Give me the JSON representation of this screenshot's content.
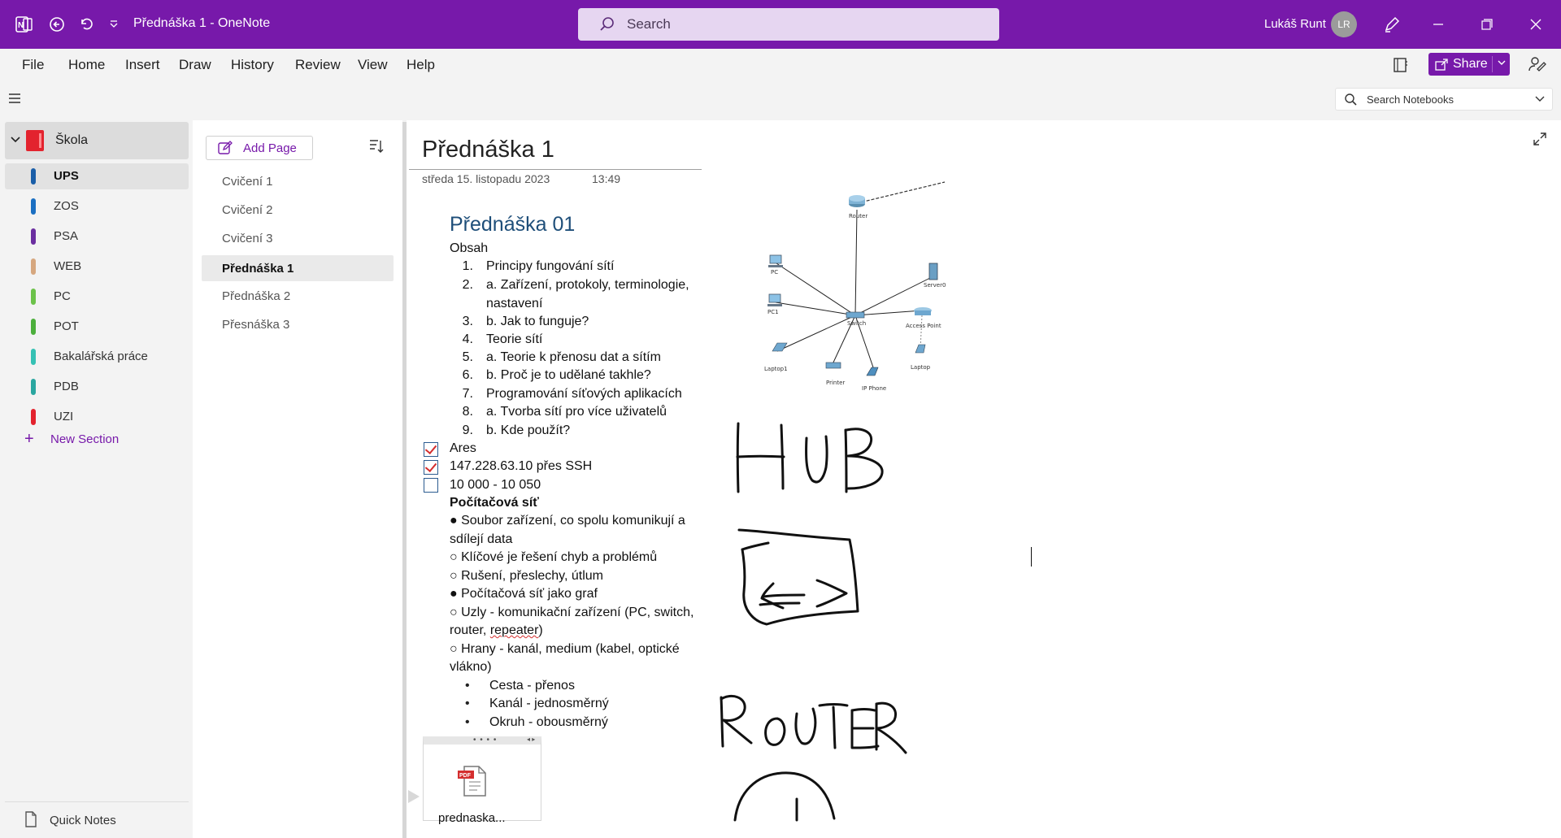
{
  "window": {
    "title": "Přednáška 1  -  OneNote",
    "search_placeholder": "Search",
    "user_name": "Lukáš Runt",
    "user_initials": "LR"
  },
  "menu": [
    "File",
    "Home",
    "Insert",
    "Draw",
    "History",
    "Review",
    "View",
    "Help"
  ],
  "share_label": "Share",
  "notebook_search_placeholder": "Search Notebooks",
  "notebook": {
    "name": "Škola",
    "color": "#e3232e",
    "sections": [
      {
        "label": "UPS",
        "color": "#1a5ea8",
        "active": true
      },
      {
        "label": "ZOS",
        "color": "#1b6fc2",
        "active": false
      },
      {
        "label": "PSA",
        "color": "#6b2fa0",
        "active": false
      },
      {
        "label": "WEB",
        "color": "#d6a77f",
        "active": false
      },
      {
        "label": "PC",
        "color": "#6cc24a",
        "active": false
      },
      {
        "label": "POT",
        "color": "#4caf3c",
        "active": false
      },
      {
        "label": "Bakalářská práce",
        "color": "#35c1b4",
        "active": false
      },
      {
        "label": "PDB",
        "color": "#2aa6a0",
        "active": false
      },
      {
        "label": "UZI",
        "color": "#e3232e",
        "active": false
      }
    ],
    "new_section_label": "New Section",
    "quick_notes_label": "Quick Notes"
  },
  "pages_panel": {
    "add_page_label": "Add Page",
    "pages": [
      {
        "label": "Cvičení 1",
        "active": false
      },
      {
        "label": "Cvičení 2",
        "active": false
      },
      {
        "label": "Cvičení 3",
        "active": false
      },
      {
        "label": "Přednáška 1",
        "active": true
      },
      {
        "label": "Přednáška 2",
        "active": false
      },
      {
        "label": "Přesnáška 3",
        "active": false
      }
    ]
  },
  "page": {
    "title": "Přednáška 1",
    "date": "středa 15. listopadu 2023",
    "time": "13:49",
    "heading": "Přednáška 01",
    "obsah_label": "Obsah",
    "toc": [
      {
        "num": "1.",
        "text": "Principy fungování sítí"
      },
      {
        "num": "2.",
        "text": "a. Zařízení, protokoly, terminologie,"
      },
      {
        "num": "",
        "text": "nastavení"
      },
      {
        "num": "3.",
        "text": "b. Jak to funguje?"
      },
      {
        "num": "4.",
        "text": "Teorie sítí"
      },
      {
        "num": "5.",
        "text": "a. Teorie k přenosu dat a sítím"
      },
      {
        "num": "6.",
        "text": "b. Proč je to udělané takhle?"
      },
      {
        "num": "7.",
        "text": "Programování síťových aplikacích"
      },
      {
        "num": "8.",
        "text": "a. Tvorba sítí pro více uživatelů"
      },
      {
        "num": "9.",
        "text": "b. Kde použít?"
      }
    ],
    "todos": [
      {
        "text": "Ares",
        "checked": true
      },
      {
        "text": "147.228.63.10 přes SSH",
        "checked": true
      },
      {
        "text": "10 000 - 10 050",
        "checked": false
      }
    ],
    "section_title": "Počítačová síť",
    "body_lines": [
      "● Soubor zařízení, co spolu komunikují a",
      "sdílejí data",
      "○ Klíčové je řešení chyb a problémů",
      "○ Rušení, přeslechy, útlum",
      "● Počítačová síť jako graf",
      "○ Uzly - komunikační zařízení (PC, switch,",
      "router, ",
      "○ Hrany - kanál, medium (kabel, optické",
      "vlákno)"
    ],
    "misspelled_word": "repeater",
    "after_misspelled": ")",
    "sub_bullets": [
      "Cesta - přenos",
      "Kanál - jednosměrný",
      "Okruh - obousměrný"
    ],
    "attachment_name": "prednaska...",
    "attachment_badge": "PDF"
  },
  "network_diagram": {
    "labels": [
      "Router",
      "PC",
      "Server0",
      "PC1",
      "Switch",
      "Access Point",
      "Laptop1",
      "Printer",
      "IP Phone",
      "Laptop"
    ]
  }
}
